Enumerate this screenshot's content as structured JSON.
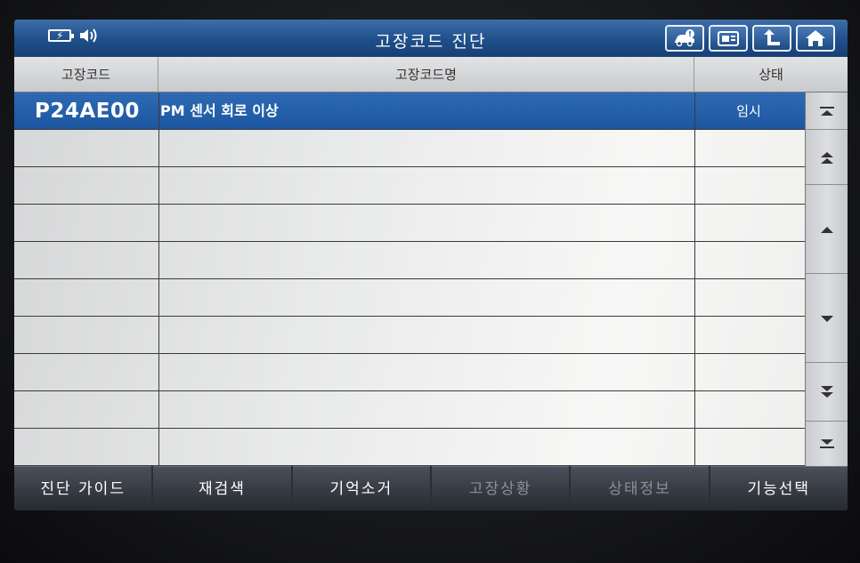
{
  "title": "고장코드 진단",
  "status_icons": [
    "battery-charging-icon",
    "speaker-icon"
  ],
  "top_buttons": [
    {
      "name": "vehicle-info-icon"
    },
    {
      "name": "screen-capture-icon"
    },
    {
      "name": "back-icon"
    },
    {
      "name": "home-icon"
    }
  ],
  "table": {
    "headers": {
      "code": "고장코드",
      "name": "고장코드명",
      "state": "상태"
    },
    "rows": [
      {
        "code": "P24AE00",
        "name": "PM 센서 회로 이상",
        "state": "임시",
        "selected": true
      }
    ],
    "empty_rows": 9
  },
  "scroll_buttons": [
    "scroll-first-icon",
    "page-up-icon",
    "scroll-up-icon",
    "scroll-down-icon",
    "page-down-icon",
    "scroll-last-icon"
  ],
  "bottom_buttons": [
    {
      "label": "진단 가이드",
      "enabled": true
    },
    {
      "label": "재검색",
      "enabled": true
    },
    {
      "label": "기억소거",
      "enabled": true
    },
    {
      "label": "고장상황",
      "enabled": false
    },
    {
      "label": "상태정보",
      "enabled": false
    },
    {
      "label": "기능선택",
      "enabled": true
    }
  ],
  "colors": {
    "title_bar": "#1f4f8a",
    "selected_row": "#1c56a0",
    "accent": "#2e6ab3"
  }
}
